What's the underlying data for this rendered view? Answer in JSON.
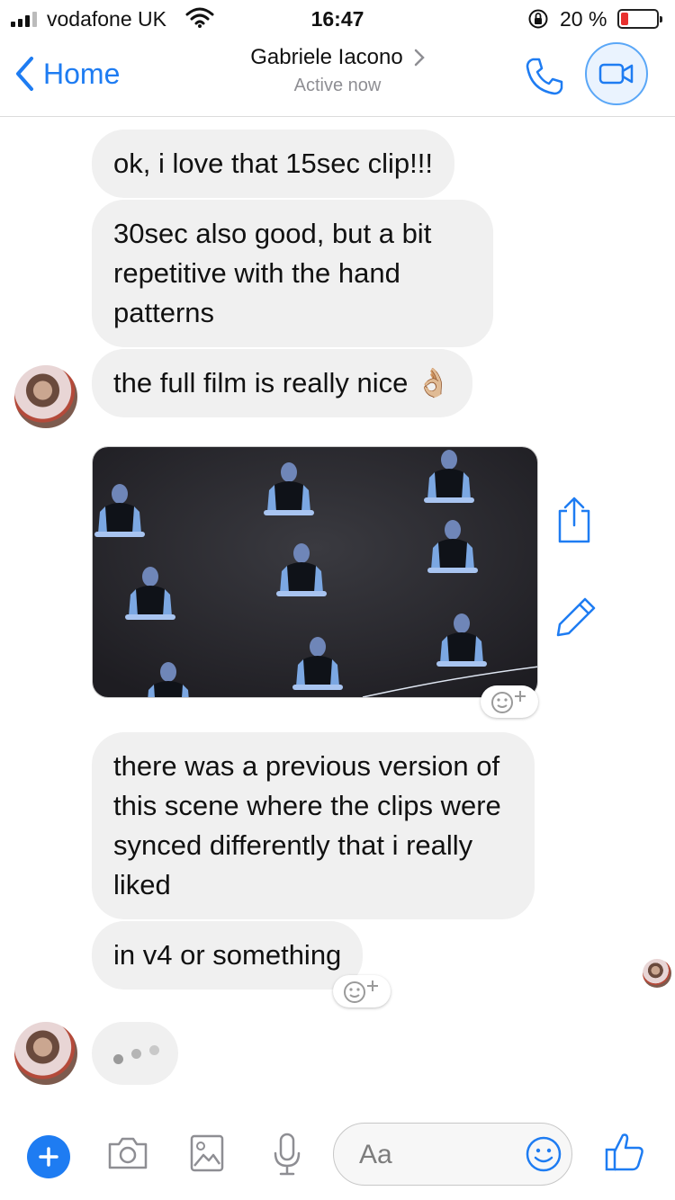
{
  "status_bar": {
    "carrier": "vodafone UK",
    "time": "16:47",
    "battery_percent_text": "20 %",
    "battery_level": 0.2
  },
  "header": {
    "back_label": "Home",
    "contact_name": "Gabriele Iacono",
    "contact_status": "Active now"
  },
  "messages": [
    {
      "text": "ok, i love that 15sec clip!!!"
    },
    {
      "text": "30sec also good, but a bit repetitive with the hand patterns"
    },
    {
      "text": "the full film is really nice 👌🏼"
    },
    {
      "text": "there was a previous version of this scene where the clips were synced differently that i really liked"
    },
    {
      "text": "in v4 or something"
    }
  ],
  "composer": {
    "placeholder": "Aa"
  },
  "colors": {
    "accent": "#1e7cf2",
    "bubble": "#f0f0f0",
    "battery_low": "#e8312f"
  },
  "icons": [
    "signal-icon",
    "wifi-icon",
    "rotation-lock-icon",
    "battery-icon",
    "chevron-left-icon",
    "chevron-right-icon",
    "phone-icon",
    "video-camera-icon",
    "share-icon",
    "edit-pencil-icon",
    "add-reaction-icon",
    "plus-icon",
    "camera-icon",
    "image-icon",
    "microphone-icon",
    "smiley-icon",
    "thumbs-up-icon"
  ]
}
